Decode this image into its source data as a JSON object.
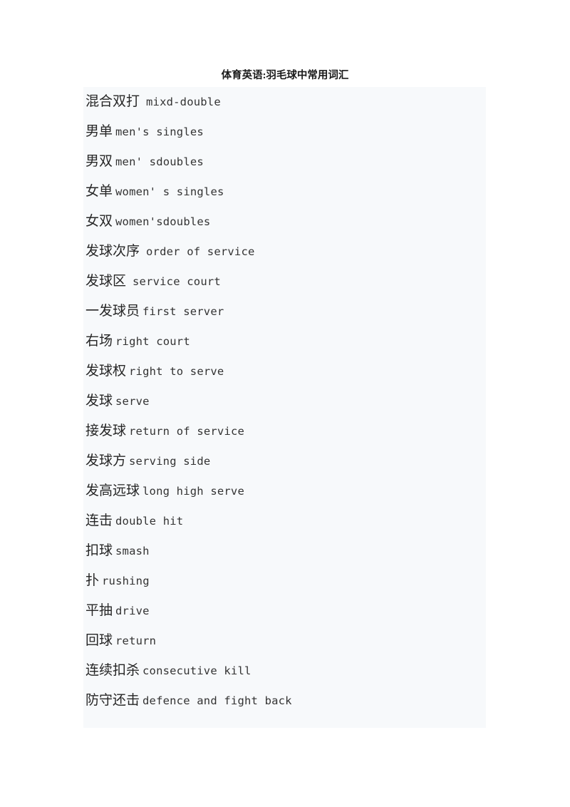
{
  "document": {
    "title": "体育英语:羽毛球中常用词汇",
    "background_color": "#ffffff",
    "content_block_color": "#f7f9fb",
    "text_color": "#262626"
  },
  "glossary": {
    "entries": [
      {
        "cn": "混合双打",
        "en": "mixd-double",
        "gap": "wide"
      },
      {
        "cn": "男单",
        "en": "men's singles",
        "gap": "narrow"
      },
      {
        "cn": "男双",
        "en": "men' sdoubles",
        "gap": "narrow"
      },
      {
        "cn": "女单",
        "en": "women' s singles",
        "gap": "narrow"
      },
      {
        "cn": "女双",
        "en": "women'sdoubles",
        "gap": "narrow"
      },
      {
        "cn": "发球次序",
        "en": "order of service",
        "gap": "wide"
      },
      {
        "cn": "发球区",
        "en": "service court",
        "gap": "wide"
      },
      {
        "cn": "一发球员",
        "en": "first server",
        "gap": "narrow"
      },
      {
        "cn": "右场",
        "en": "right court",
        "gap": "narrow"
      },
      {
        "cn": "发球权",
        "en": "right to serve",
        "gap": "narrow"
      },
      {
        "cn": "发球",
        "en": "serve",
        "gap": "narrow"
      },
      {
        "cn": "接发球",
        "en": "return of service",
        "gap": "narrow"
      },
      {
        "cn": "发球方",
        "en": "serving side",
        "gap": "narrow"
      },
      {
        "cn": "发高远球",
        "en": "long high serve",
        "gap": "narrow"
      },
      {
        "cn": "连击",
        "en": "double hit",
        "gap": "narrow"
      },
      {
        "cn": "扣球",
        "en": "smash",
        "gap": "narrow"
      },
      {
        "cn": "扑",
        "en": "rushing",
        "gap": "narrow"
      },
      {
        "cn": "平抽",
        "en": "drive",
        "gap": "narrow"
      },
      {
        "cn": "回球",
        "en": "return",
        "gap": "narrow"
      },
      {
        "cn": "连续扣杀",
        "en": "consecutive kill",
        "gap": "narrow"
      },
      {
        "cn": "防守还击",
        "en": "defence and fight back",
        "gap": "narrow"
      }
    ]
  }
}
